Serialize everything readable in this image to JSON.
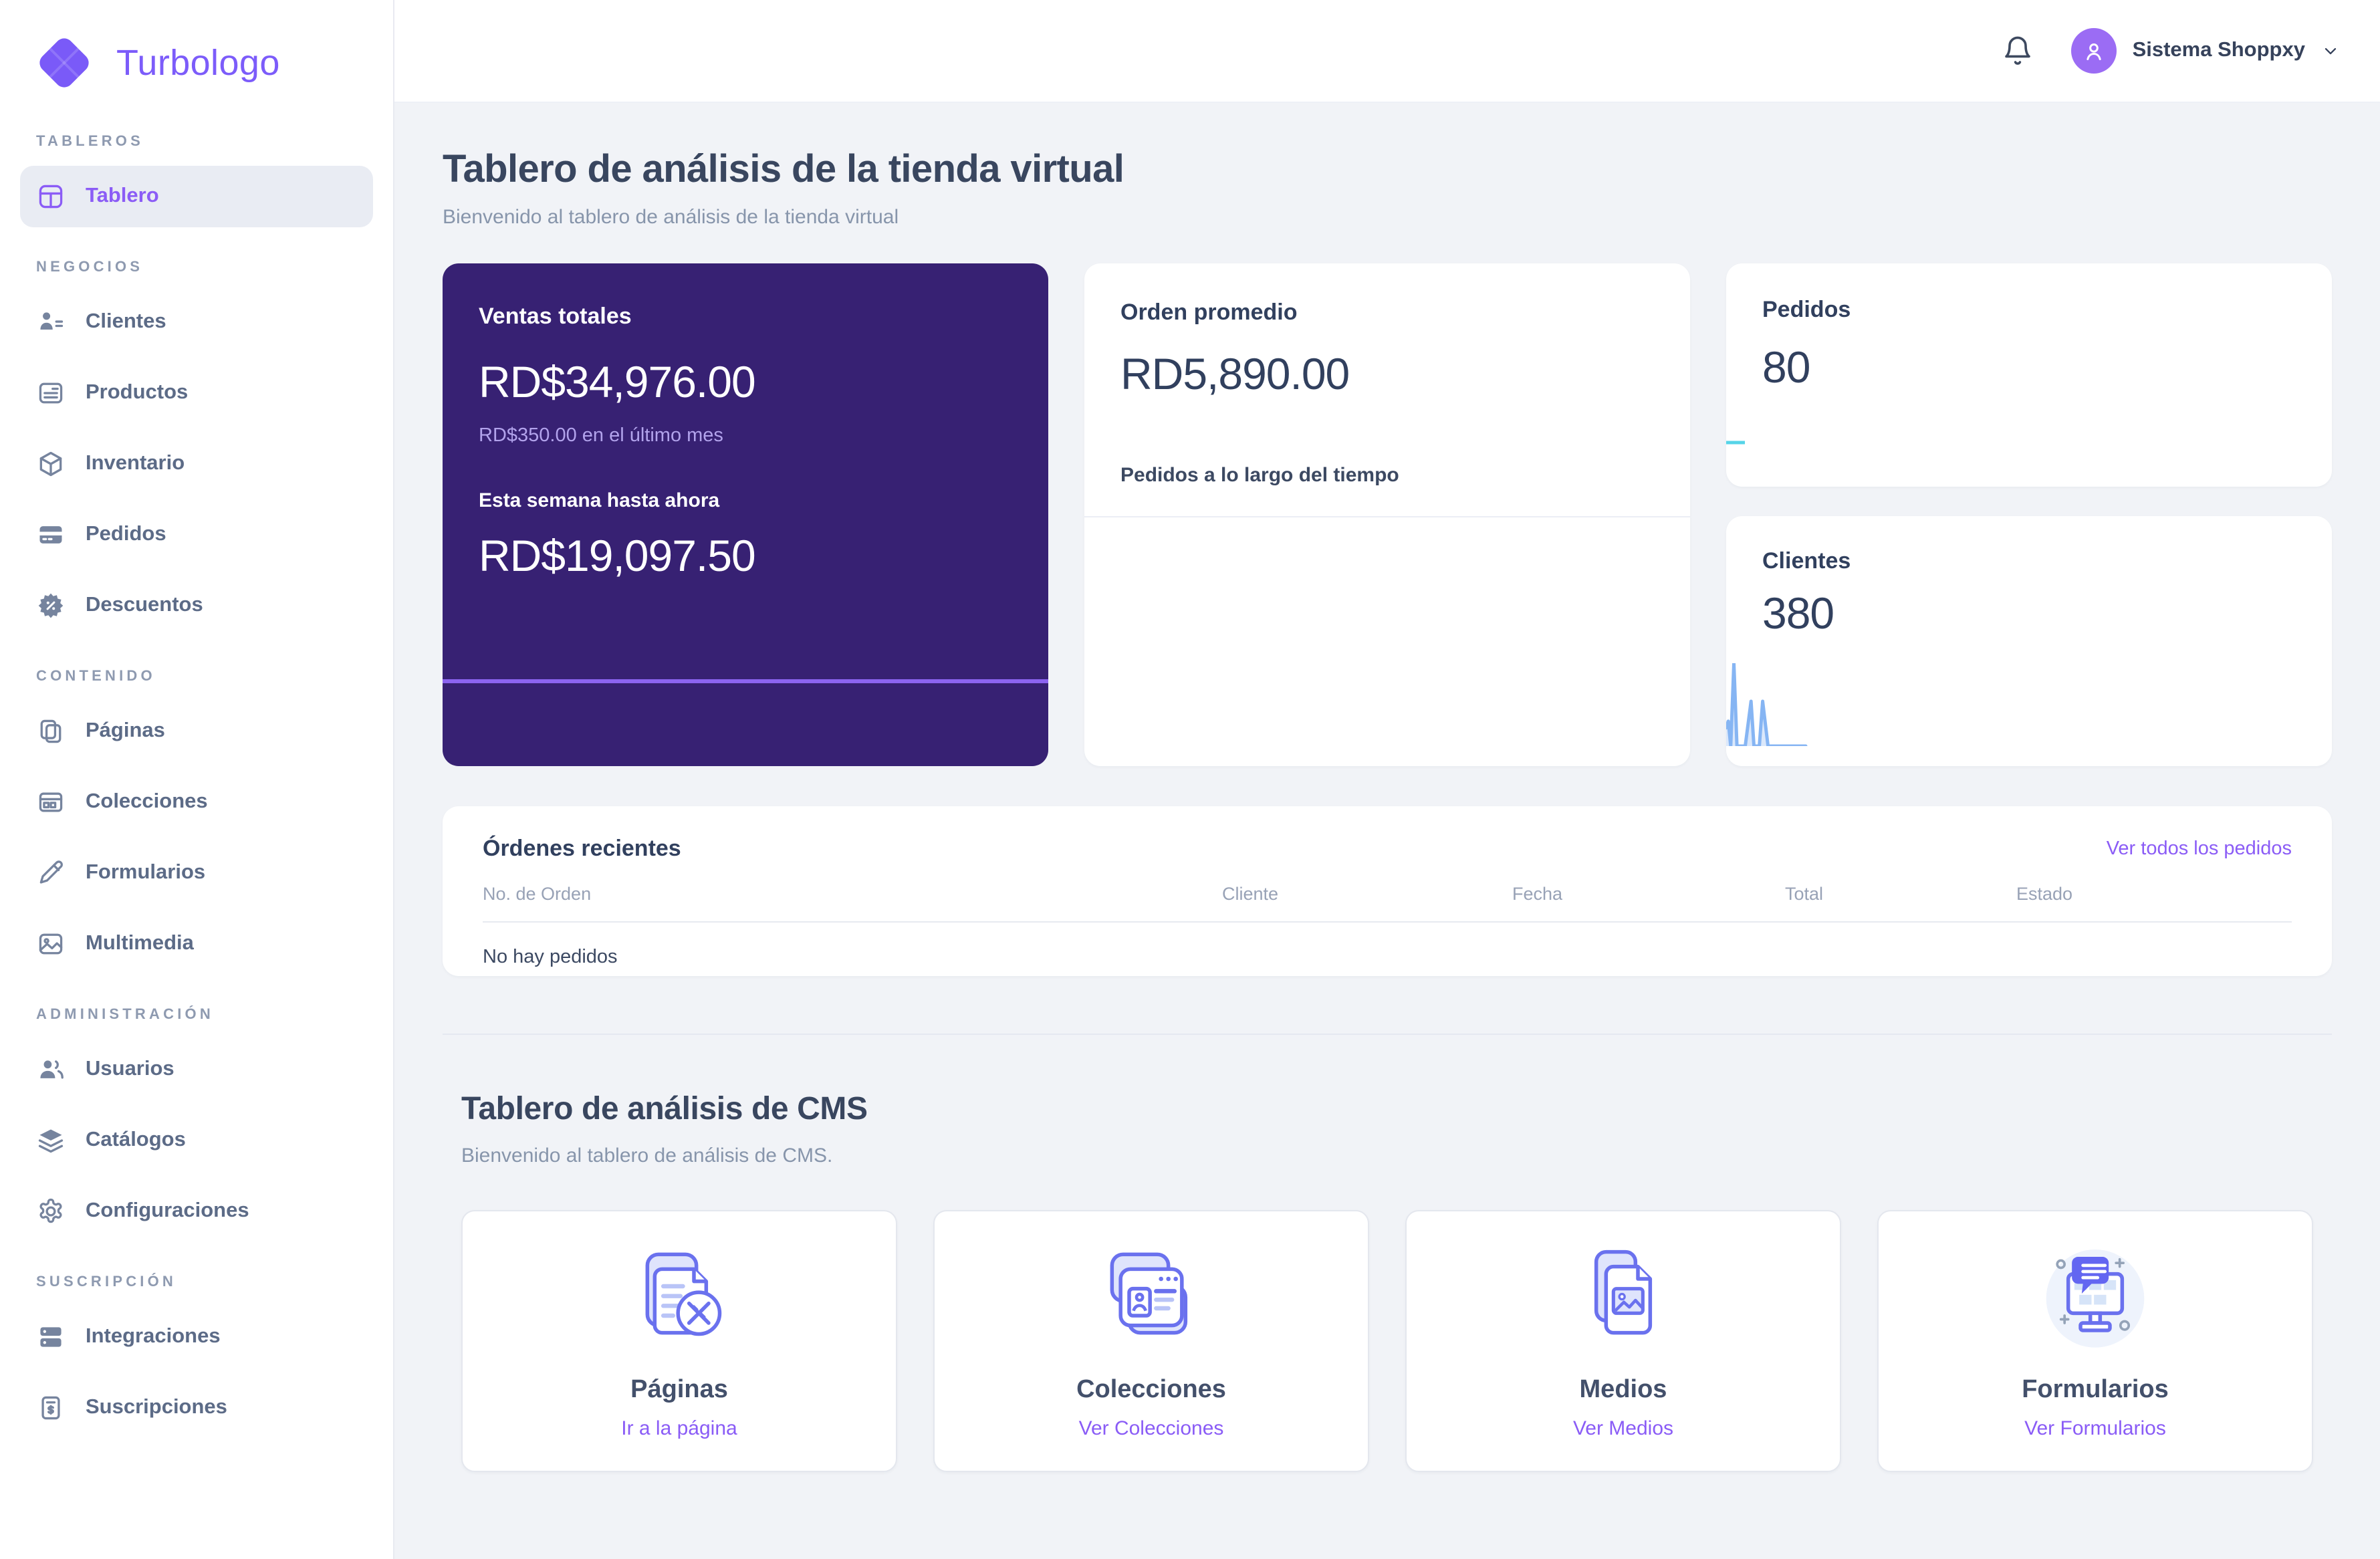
{
  "brand": {
    "name": "Turbologo"
  },
  "header": {
    "user_name": "Sistema Shoppxy"
  },
  "sidebar": {
    "sections": [
      {
        "label": "TABLEROS",
        "items": [
          {
            "label": "Tablero",
            "icon": "dashboard-icon",
            "active": true
          }
        ]
      },
      {
        "label": "NEGOCIOS",
        "items": [
          {
            "label": "Clientes",
            "icon": "clients-icon"
          },
          {
            "label": "Productos",
            "icon": "products-icon"
          },
          {
            "label": "Inventario",
            "icon": "inventory-icon"
          },
          {
            "label": "Pedidos",
            "icon": "orders-icon"
          },
          {
            "label": "Descuentos",
            "icon": "discounts-icon"
          }
        ]
      },
      {
        "label": "CONTENIDO",
        "items": [
          {
            "label": "Páginas",
            "icon": "pages-icon"
          },
          {
            "label": "Colecciones",
            "icon": "collections-icon"
          },
          {
            "label": "Formularios",
            "icon": "forms-icon"
          },
          {
            "label": "Multimedia",
            "icon": "multimedia-icon"
          }
        ]
      },
      {
        "label": "ADMINISTRACIÓN",
        "items": [
          {
            "label": "Usuarios",
            "icon": "users-icon"
          },
          {
            "label": "Catálogos",
            "icon": "catalogs-icon"
          },
          {
            "label": "Configuraciones",
            "icon": "settings-icon"
          }
        ]
      },
      {
        "label": "SUSCRIPCIÓN",
        "items": [
          {
            "label": "Integraciones",
            "icon": "integrations-icon"
          },
          {
            "label": "Suscripciones",
            "icon": "subscriptions-icon"
          }
        ]
      }
    ]
  },
  "store": {
    "title": "Tablero de análisis de la tienda virtual",
    "subtitle": "Bienvenido al tablero de análisis de la tienda virtual",
    "sales": {
      "title": "Ventas totales",
      "total": "RD$34,976.00",
      "last_month": "RD$350.00 en el último mes",
      "week_label": "Esta semana hasta ahora",
      "week_value": "RD$19,097.50"
    },
    "avg": {
      "title": "Orden promedio",
      "value": "RD5,890.00",
      "chart_label": "Pedidos a lo largo del tiempo"
    },
    "orders": {
      "title": "Pedidos",
      "value": "80"
    },
    "customers": {
      "title": "Clientes",
      "value": "380"
    }
  },
  "recent": {
    "title": "Órdenes recientes",
    "link": "Ver todos los pedidos",
    "columns": [
      "No. de Orden",
      "Cliente",
      "Fecha",
      "Total",
      "Estado"
    ],
    "empty": "No hay pedidos"
  },
  "cms": {
    "title": "Tablero de análisis de CMS",
    "subtitle": "Bienvenido al tablero de análisis de CMS.",
    "cards": [
      {
        "title": "Páginas",
        "link": "Ir a la página",
        "icon": "cms-pages-icon"
      },
      {
        "title": "Colecciones",
        "link": "Ver Colecciones",
        "icon": "cms-collections-icon"
      },
      {
        "title": "Medios",
        "link": "Ver Medios",
        "icon": "cms-media-icon"
      },
      {
        "title": "Formularios",
        "link": "Ver Formularios",
        "icon": "cms-forms-icon"
      }
    ]
  },
  "chart_data": [
    {
      "name": "orders_trend",
      "type": "line",
      "title": "Pedidos",
      "stroke": "#56d4e8",
      "points": [
        [
          0,
          50
        ],
        [
          100,
          50
        ]
      ]
    },
    {
      "name": "customers_trend",
      "type": "area",
      "title": "Clientes",
      "stroke": "#86b5f3",
      "fill": "#dbe8fb",
      "points": [
        [
          0,
          22
        ],
        [
          2.5,
          30
        ],
        [
          5.5,
          0
        ],
        [
          9.3,
          100
        ],
        [
          13,
          0
        ],
        [
          23,
          0
        ],
        [
          30,
          54
        ],
        [
          33.5,
          0
        ],
        [
          40,
          0
        ],
        [
          44,
          54
        ],
        [
          50.5,
          0
        ],
        [
          96,
          0
        ]
      ]
    }
  ],
  "colors": {
    "brand_purple": "#7c5cfa",
    "accent_purple": "#8b5cf6",
    "sales_card_bg": "#372173",
    "sales_card_line": "#8c64f0",
    "orders_line_cyan": "#56d4e8",
    "customers_spark_stroke": "#86b5f3",
    "customers_spark_fill": "#dbe8fb",
    "page_bg": "#f1f3f7"
  }
}
